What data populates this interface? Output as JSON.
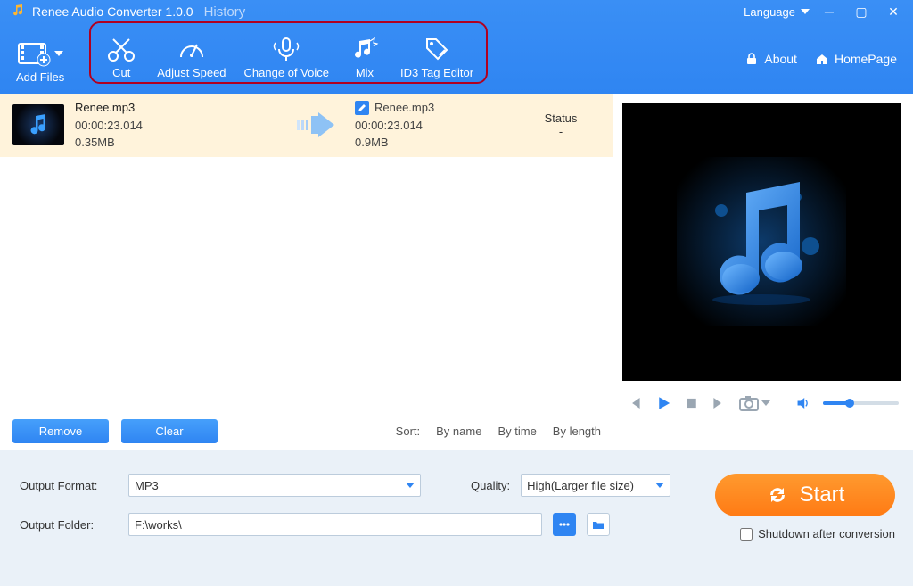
{
  "titlebar": {
    "app_title": "Renee Audio Converter 1.0.0",
    "history": "History",
    "language_label": "Language"
  },
  "toolbar": {
    "add_files": "Add Files",
    "cut": "Cut",
    "adjust_speed": "Adjust Speed",
    "change_voice": "Change of Voice",
    "mix": "Mix",
    "id3": "ID3 Tag Editor"
  },
  "top_links": {
    "about": "About",
    "homepage": "HomePage"
  },
  "file_row": {
    "src": {
      "name": "Renee.mp3",
      "duration": "00:00:23.014",
      "size": "0.35MB"
    },
    "dst": {
      "name": "Renee.mp3",
      "duration": "00:00:23.014",
      "size": "0.9MB"
    },
    "status_label": "Status",
    "status_value": "-"
  },
  "buttons": {
    "remove": "Remove",
    "clear": "Clear"
  },
  "sort": {
    "label": "Sort:",
    "by_name": "By name",
    "by_time": "By time",
    "by_length": "By length"
  },
  "settings": {
    "output_format_label": "Output Format:",
    "output_format_value": "MP3",
    "quality_label": "Quality:",
    "quality_value": "High(Larger file size)",
    "output_folder_label": "Output Folder:",
    "output_folder_value": "F:\\works\\"
  },
  "start": {
    "label": "Start",
    "shutdown_label": "Shutdown after conversion"
  }
}
